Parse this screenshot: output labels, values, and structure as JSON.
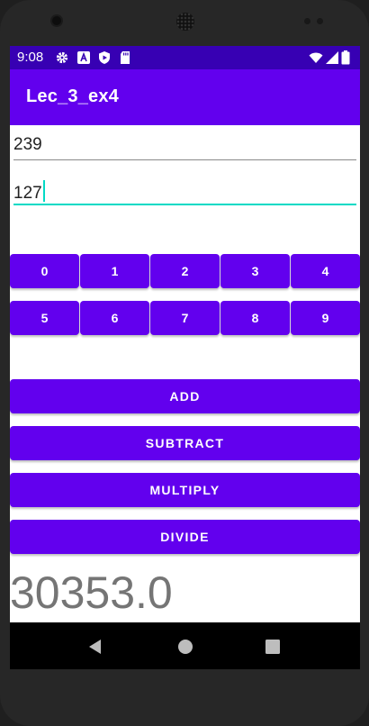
{
  "status_bar": {
    "time": "9:08",
    "left_icons": [
      "settings-icon",
      "a-icon",
      "shield-icon",
      "sd-card-icon"
    ],
    "right_icons": [
      "wifi-icon",
      "signal-icon",
      "battery-icon"
    ]
  },
  "app_bar": {
    "title": "Lec_3_ex4"
  },
  "inputs": {
    "first": {
      "value": "239"
    },
    "second": {
      "value": "127",
      "focused": true
    }
  },
  "digits": {
    "row1": [
      "0",
      "1",
      "2",
      "3",
      "4"
    ],
    "row2": [
      "5",
      "6",
      "7",
      "8",
      "9"
    ]
  },
  "operations": {
    "add": "ADD",
    "subtract": "SUBTRACT",
    "multiply": "MULTIPLY",
    "divide": "DIVIDE"
  },
  "result": "30353.0",
  "colors": {
    "status_bar": "#3700b3",
    "primary": "#6200ee",
    "accent": "#03dac5",
    "result_text": "#757575"
  },
  "nav_bar": [
    "back-icon",
    "home-icon",
    "recents-icon"
  ]
}
